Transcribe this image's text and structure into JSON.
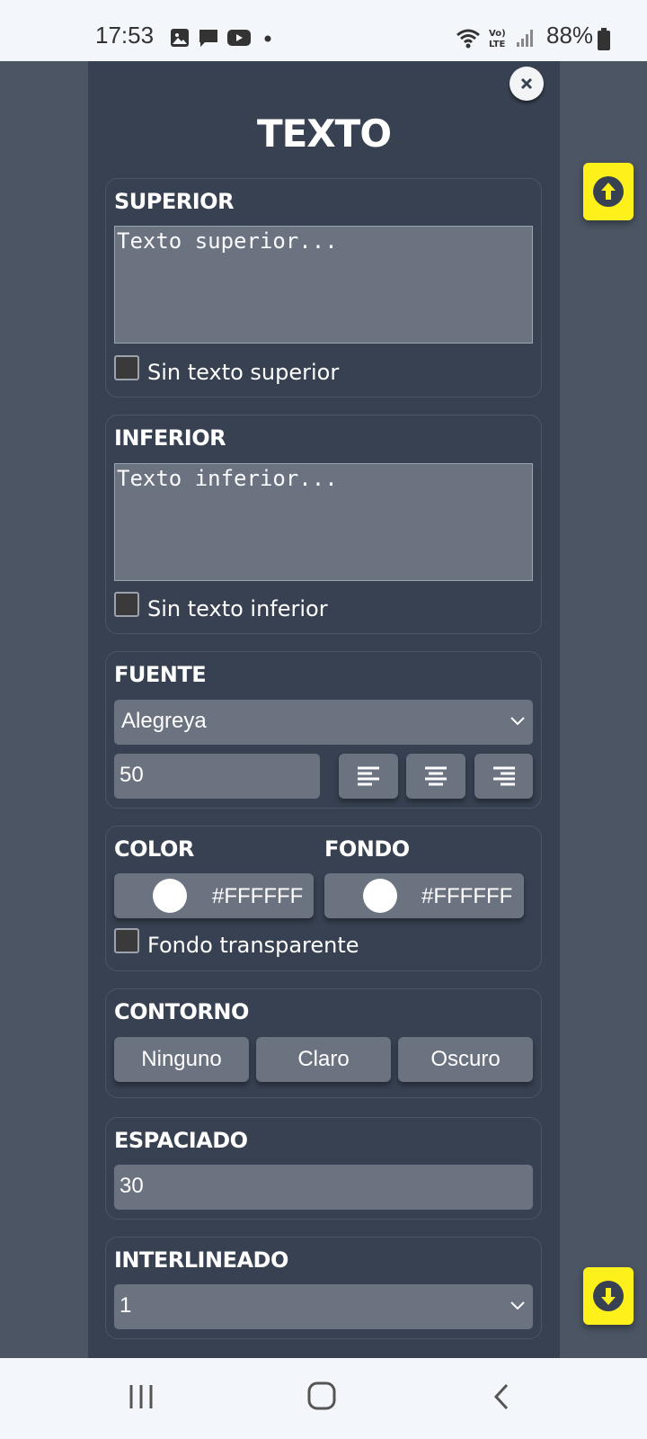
{
  "status": {
    "time": "17:53",
    "battery": "88%",
    "network": "LTE"
  },
  "panel": {
    "title": "TEXTO",
    "close_icon": "close-icon"
  },
  "superior": {
    "label": "SUPERIOR",
    "placeholder": "Texto superior...",
    "checkbox_label": "Sin texto superior"
  },
  "inferior": {
    "label": "INFERIOR",
    "placeholder": "Texto inferior...",
    "checkbox_label": "Sin texto inferior"
  },
  "fuente": {
    "label": "FUENTE",
    "selected": "Alegreya",
    "size": "50",
    "align_icons": [
      "align-left-icon",
      "align-center-icon",
      "align-right-icon"
    ]
  },
  "color": {
    "label": "COLOR",
    "value": "#FFFFFF"
  },
  "fondo": {
    "label": "FONDO",
    "value": "#FFFFFF",
    "checkbox_label": "Fondo transparente"
  },
  "contorno": {
    "label": "CONTORNO",
    "options": [
      "Ninguno",
      "Claro",
      "Oscuro"
    ]
  },
  "espaciado": {
    "label": "ESPACIADO",
    "value": "30"
  },
  "interlineado": {
    "label": "INTERLINEADO",
    "selected": "1"
  },
  "colors": {
    "panel": "#374151",
    "backdrop": "#4b5563",
    "field": "#6b7280",
    "accent_yellow": "#fef01b"
  }
}
